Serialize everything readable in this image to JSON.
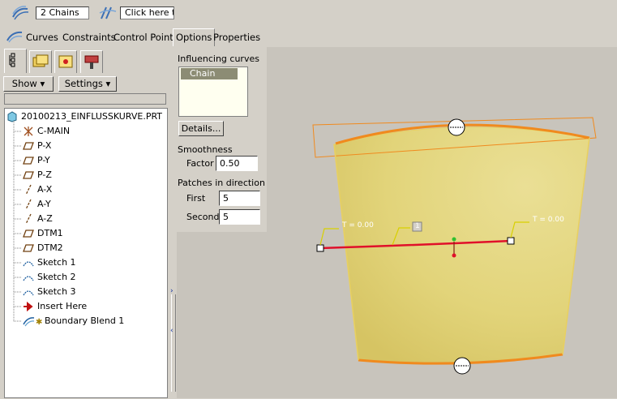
{
  "chain_bar": {
    "chains_value": "2 Chains",
    "hint_value": "Click here t"
  },
  "tabs": [
    "Curves",
    "Constraints",
    "Control Points",
    "Options",
    "Properties"
  ],
  "active_tab": "Options",
  "left_panel": {
    "show_label": "Show",
    "settings_label": "Settings",
    "tree": [
      {
        "label": "20100213_EINFLUSSKURVE.PRT",
        "icon": "part-icon"
      },
      {
        "label": "C-MAIN",
        "icon": "csys-icon"
      },
      {
        "label": "P-X",
        "icon": "datum-plane-icon"
      },
      {
        "label": "P-Y",
        "icon": "datum-plane-icon"
      },
      {
        "label": "P-Z",
        "icon": "datum-plane-icon"
      },
      {
        "label": "A-X",
        "icon": "datum-axis-icon"
      },
      {
        "label": "A-Y",
        "icon": "datum-axis-icon"
      },
      {
        "label": "A-Z",
        "icon": "datum-axis-icon"
      },
      {
        "label": "DTM1",
        "icon": "datum-plane-icon"
      },
      {
        "label": "DTM2",
        "icon": "datum-plane-icon"
      },
      {
        "label": "Sketch 1",
        "icon": "sketch-icon"
      },
      {
        "label": "Sketch 2",
        "icon": "sketch-icon"
      },
      {
        "label": "Sketch 3",
        "icon": "sketch-icon"
      },
      {
        "label": "Insert Here",
        "icon": "insert-arrow-icon"
      },
      {
        "label": "Boundary Blend 1",
        "icon": "boundary-blend-icon"
      }
    ]
  },
  "options": {
    "influencing_curves_label": "Influencing curves",
    "chain_item": "Chain",
    "details_label": "Details...",
    "smoothness_label": "Smoothness",
    "factor_label": "Factor",
    "factor_value": "0.50",
    "patches_label": "Patches in direction",
    "first_label": "First",
    "first_value": "5",
    "second_label": "Second",
    "second_value": "5"
  },
  "viewport": {
    "left_param": "T = 0.00",
    "right_param": "T = 0.00",
    "curve_tag": "1",
    "surface_color": "#e6d882",
    "edge_color": "#f08a1e",
    "curve_color": "#e0102a"
  }
}
